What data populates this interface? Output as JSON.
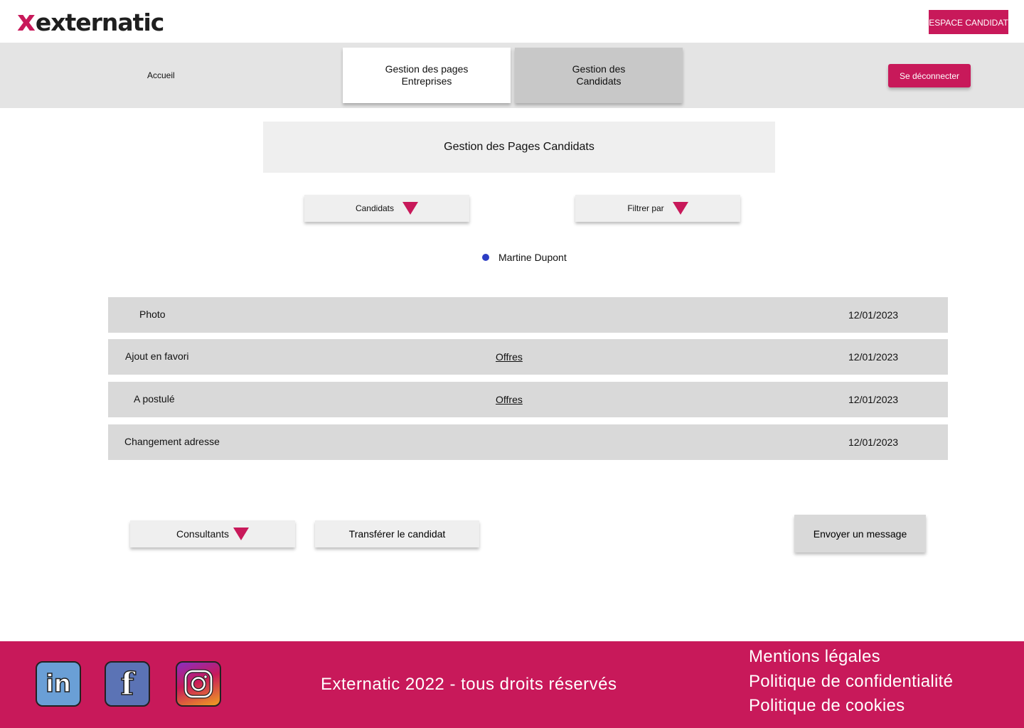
{
  "header": {
    "logo_x": "x",
    "logo_text": "externatic",
    "espace_button": "ESPACE CANDIDAT"
  },
  "nav": {
    "home": "Accueil",
    "tabs": [
      {
        "label": "Gestion des pages Entreprises",
        "active": true
      },
      {
        "label": "Gestion des Candidats",
        "active": false
      }
    ],
    "logout": "Se déconnecter"
  },
  "main": {
    "title": "Gestion des Pages Candidats",
    "dropdown_candidates": "Candidats",
    "dropdown_filter": "Filtrer par",
    "candidate_name": "Martine Dupont",
    "activities": [
      {
        "label": "Photo",
        "link": "",
        "date": "12/01/2023"
      },
      {
        "label": "Ajout en favori",
        "link": "Offres",
        "date": "12/01/2023"
      },
      {
        "label": "A postulé",
        "link": "Offres",
        "date": "12/01/2023"
      },
      {
        "label": "Changement adresse",
        "link": "",
        "date": "12/01/2023"
      }
    ],
    "dropdown_consultants": "Consultants",
    "transfer_button": "Transférer le candidat",
    "message_button": "Envoyer un message"
  },
  "footer": {
    "social": [
      {
        "icon": "linkedin-icon",
        "glyph": "in"
      },
      {
        "icon": "facebook-icon",
        "glyph": "f"
      },
      {
        "icon": "instagram-icon",
        "glyph": ""
      }
    ],
    "copyright": "Externatic 2022 - tous droits réservés",
    "links": [
      "Mentions légales",
      "Politique de confidentialité",
      "Politique de cookies"
    ]
  },
  "colors": {
    "brand": "#c8195a",
    "dot": "#2d3ec4",
    "nav_bg": "#e4e4e4",
    "row_bg": "#d9d9d9"
  }
}
